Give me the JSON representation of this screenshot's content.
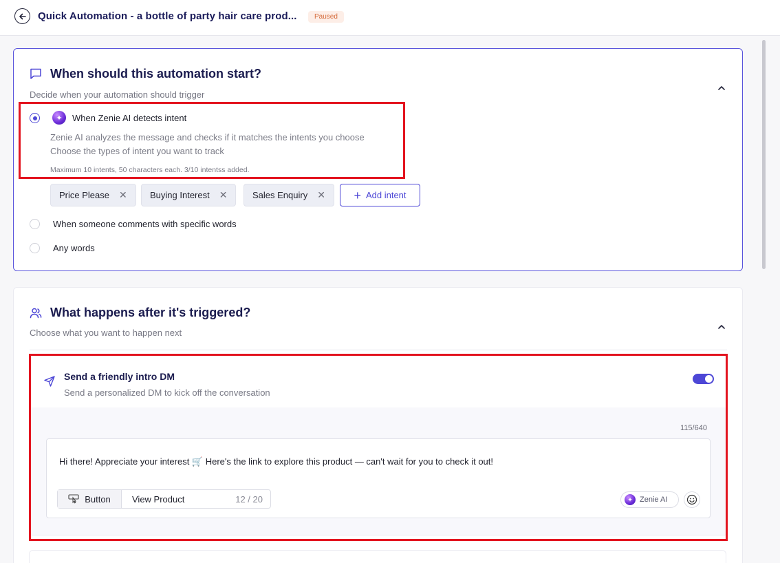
{
  "header": {
    "title": "Quick Automation - a bottle of party hair care prod...",
    "status": "Paused"
  },
  "trigger_section": {
    "title": "When should this automation start?",
    "subtitle": "Decide when your automation should trigger",
    "options": [
      {
        "label": "When Zenie AI detects intent",
        "selected": true,
        "description_line1": "Zenie AI analyzes the message and checks if it matches the intents you choose",
        "description_line2": "Choose the types of intent you want to track",
        "note": "Maximum 10 intents, 50 characters each. 3/10 intentss added."
      },
      {
        "label": "When someone comments with specific words",
        "selected": false
      },
      {
        "label": "Any words",
        "selected": false
      }
    ],
    "intents": [
      "Price Please",
      "Buying Interest",
      "Sales Enquiry"
    ],
    "add_intent_label": "Add intent"
  },
  "action_section": {
    "title": "What happens after it's triggered?",
    "subtitle": "Choose what you want to happen next",
    "dm": {
      "title": "Send a friendly intro DM",
      "subtitle": "Send a personalized DM to kick off the conversation",
      "enabled": true,
      "char_count": "115/640",
      "message": "Hi there! Appreciate your interest 🛒 Here's the link to explore this product — can't wait for you to check it out!",
      "button_kind": "Button",
      "button_label": "View Product",
      "button_count": "12 / 20",
      "ai_label": "Zenie AI"
    }
  },
  "colors": {
    "accent": "#4d47d6",
    "title": "#1b1c5a",
    "highlight": "#e3141f",
    "badge_bg": "#fdeee7",
    "badge_text": "#d56b3b"
  }
}
